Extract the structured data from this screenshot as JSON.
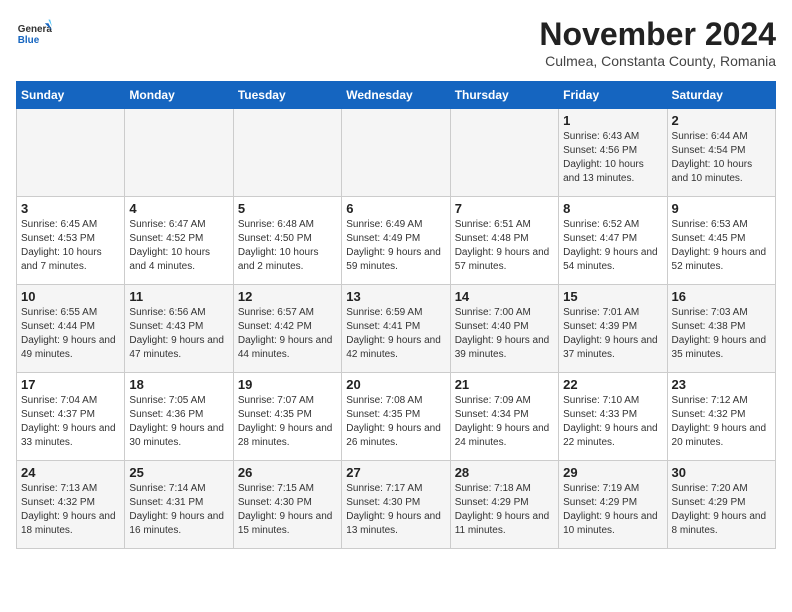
{
  "header": {
    "logo_general": "General",
    "logo_blue": "Blue",
    "month_title": "November 2024",
    "location": "Culmea, Constanta County, Romania"
  },
  "days_of_week": [
    "Sunday",
    "Monday",
    "Tuesday",
    "Wednesday",
    "Thursday",
    "Friday",
    "Saturday"
  ],
  "weeks": [
    [
      {
        "day": "",
        "info": ""
      },
      {
        "day": "",
        "info": ""
      },
      {
        "day": "",
        "info": ""
      },
      {
        "day": "",
        "info": ""
      },
      {
        "day": "",
        "info": ""
      },
      {
        "day": "1",
        "info": "Sunrise: 6:43 AM\nSunset: 4:56 PM\nDaylight: 10 hours and 13 minutes."
      },
      {
        "day": "2",
        "info": "Sunrise: 6:44 AM\nSunset: 4:54 PM\nDaylight: 10 hours and 10 minutes."
      }
    ],
    [
      {
        "day": "3",
        "info": "Sunrise: 6:45 AM\nSunset: 4:53 PM\nDaylight: 10 hours and 7 minutes."
      },
      {
        "day": "4",
        "info": "Sunrise: 6:47 AM\nSunset: 4:52 PM\nDaylight: 10 hours and 4 minutes."
      },
      {
        "day": "5",
        "info": "Sunrise: 6:48 AM\nSunset: 4:50 PM\nDaylight: 10 hours and 2 minutes."
      },
      {
        "day": "6",
        "info": "Sunrise: 6:49 AM\nSunset: 4:49 PM\nDaylight: 9 hours and 59 minutes."
      },
      {
        "day": "7",
        "info": "Sunrise: 6:51 AM\nSunset: 4:48 PM\nDaylight: 9 hours and 57 minutes."
      },
      {
        "day": "8",
        "info": "Sunrise: 6:52 AM\nSunset: 4:47 PM\nDaylight: 9 hours and 54 minutes."
      },
      {
        "day": "9",
        "info": "Sunrise: 6:53 AM\nSunset: 4:45 PM\nDaylight: 9 hours and 52 minutes."
      }
    ],
    [
      {
        "day": "10",
        "info": "Sunrise: 6:55 AM\nSunset: 4:44 PM\nDaylight: 9 hours and 49 minutes."
      },
      {
        "day": "11",
        "info": "Sunrise: 6:56 AM\nSunset: 4:43 PM\nDaylight: 9 hours and 47 minutes."
      },
      {
        "day": "12",
        "info": "Sunrise: 6:57 AM\nSunset: 4:42 PM\nDaylight: 9 hours and 44 minutes."
      },
      {
        "day": "13",
        "info": "Sunrise: 6:59 AM\nSunset: 4:41 PM\nDaylight: 9 hours and 42 minutes."
      },
      {
        "day": "14",
        "info": "Sunrise: 7:00 AM\nSunset: 4:40 PM\nDaylight: 9 hours and 39 minutes."
      },
      {
        "day": "15",
        "info": "Sunrise: 7:01 AM\nSunset: 4:39 PM\nDaylight: 9 hours and 37 minutes."
      },
      {
        "day": "16",
        "info": "Sunrise: 7:03 AM\nSunset: 4:38 PM\nDaylight: 9 hours and 35 minutes."
      }
    ],
    [
      {
        "day": "17",
        "info": "Sunrise: 7:04 AM\nSunset: 4:37 PM\nDaylight: 9 hours and 33 minutes."
      },
      {
        "day": "18",
        "info": "Sunrise: 7:05 AM\nSunset: 4:36 PM\nDaylight: 9 hours and 30 minutes."
      },
      {
        "day": "19",
        "info": "Sunrise: 7:07 AM\nSunset: 4:35 PM\nDaylight: 9 hours and 28 minutes."
      },
      {
        "day": "20",
        "info": "Sunrise: 7:08 AM\nSunset: 4:35 PM\nDaylight: 9 hours and 26 minutes."
      },
      {
        "day": "21",
        "info": "Sunrise: 7:09 AM\nSunset: 4:34 PM\nDaylight: 9 hours and 24 minutes."
      },
      {
        "day": "22",
        "info": "Sunrise: 7:10 AM\nSunset: 4:33 PM\nDaylight: 9 hours and 22 minutes."
      },
      {
        "day": "23",
        "info": "Sunrise: 7:12 AM\nSunset: 4:32 PM\nDaylight: 9 hours and 20 minutes."
      }
    ],
    [
      {
        "day": "24",
        "info": "Sunrise: 7:13 AM\nSunset: 4:32 PM\nDaylight: 9 hours and 18 minutes."
      },
      {
        "day": "25",
        "info": "Sunrise: 7:14 AM\nSunset: 4:31 PM\nDaylight: 9 hours and 16 minutes."
      },
      {
        "day": "26",
        "info": "Sunrise: 7:15 AM\nSunset: 4:30 PM\nDaylight: 9 hours and 15 minutes."
      },
      {
        "day": "27",
        "info": "Sunrise: 7:17 AM\nSunset: 4:30 PM\nDaylight: 9 hours and 13 minutes."
      },
      {
        "day": "28",
        "info": "Sunrise: 7:18 AM\nSunset: 4:29 PM\nDaylight: 9 hours and 11 minutes."
      },
      {
        "day": "29",
        "info": "Sunrise: 7:19 AM\nSunset: 4:29 PM\nDaylight: 9 hours and 10 minutes."
      },
      {
        "day": "30",
        "info": "Sunrise: 7:20 AM\nSunset: 4:29 PM\nDaylight: 9 hours and 8 minutes."
      }
    ]
  ]
}
